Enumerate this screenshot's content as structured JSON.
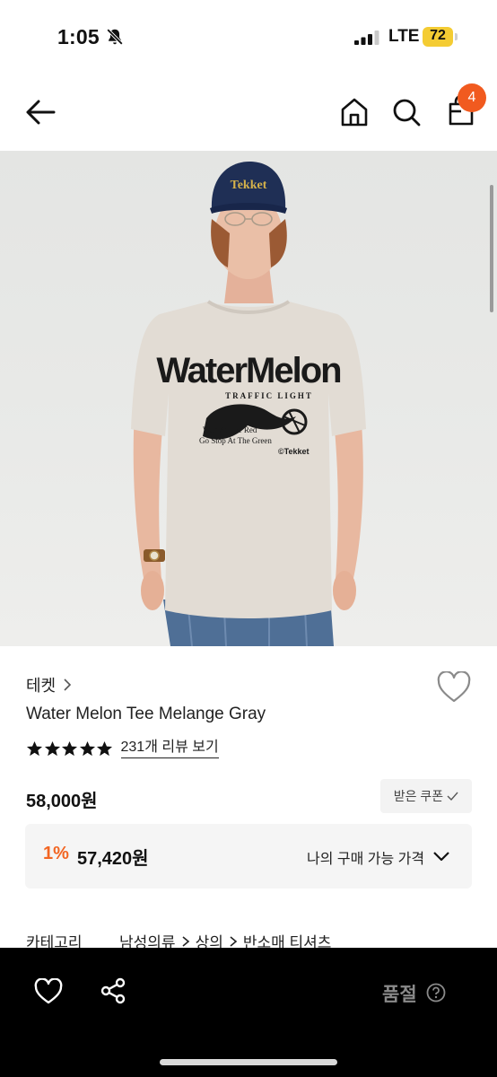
{
  "status_bar": {
    "time": "1:05",
    "network": "LTE",
    "battery": "72",
    "icons": [
      "bell-slash-icon",
      "signal-icon",
      "battery-icon"
    ]
  },
  "nav": {
    "icons": [
      "back-arrow-icon",
      "home-icon",
      "search-icon",
      "bag-icon"
    ],
    "cart_count": "4"
  },
  "product": {
    "brand": "테켓",
    "name": "Water Melon Tee Melange Gray",
    "rating_stars": 5,
    "review_link": "231개 리뷰 보기",
    "price": "58,000원",
    "coupon_button": "받은 쿠폰",
    "my_price": {
      "discount": "1%",
      "price": "57,420원",
      "label": "나의 구매 가능 가격"
    },
    "category": {
      "label": "카테고리",
      "path": [
        "남성의류",
        "상의",
        "반소매 티셔츠"
      ]
    },
    "shirt_print": {
      "title": "WaterMelon",
      "subtitle": "TRAFFIC LIGHT",
      "line1": "Wait At The Red",
      "line2": "Go Stop At The Green",
      "logo": "©Tekket",
      "cap_logo": "Tekket"
    }
  },
  "bottom_bar": {
    "sold_out": "품절",
    "icons": [
      "heart-icon",
      "share-icon",
      "help-icon"
    ]
  },
  "colors": {
    "accent": "#f26522",
    "badge": "#f15a1f",
    "bottom_bar": "#000000",
    "battery": "#f4cc33"
  }
}
